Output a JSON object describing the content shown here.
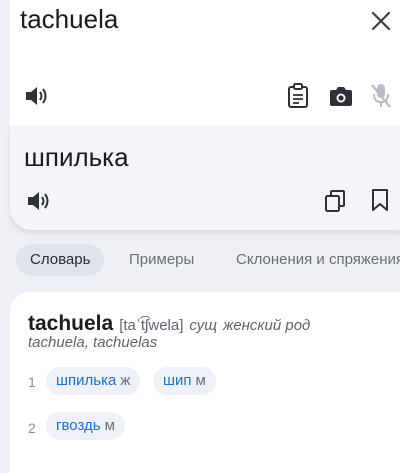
{
  "source": {
    "text": "tachuela"
  },
  "target": {
    "text": "шпилька"
  },
  "icons": {
    "close": "close-icon",
    "speaker": "speaker-icon",
    "clipboard": "clipboard-icon",
    "camera": "camera-icon",
    "mic_off": "mic-off-icon",
    "copy": "copy-icon",
    "bookmark": "bookmark-icon"
  },
  "tabs": [
    {
      "label": "Словарь",
      "active": true
    },
    {
      "label": "Примеры",
      "active": false
    },
    {
      "label": "Склонения и спряжения",
      "active": false
    }
  ],
  "dictionary": {
    "headword": "tachuela",
    "pronunciation": "[taˈt͡ʃwela]",
    "part_of_speech": "сущ",
    "gender": "женский род",
    "forms": "tachuela, tachuelas",
    "senses": [
      {
        "number": "1",
        "translations": [
          {
            "word": "шпилька",
            "gender": "ж"
          },
          {
            "word": "шип",
            "gender": "м"
          }
        ]
      },
      {
        "number": "2",
        "translations": [
          {
            "word": "гвоздь",
            "gender": "м"
          }
        ]
      }
    ]
  },
  "colors": {
    "link": "#1a73c8",
    "background": "#eef0f6",
    "chip": "#eef1f7"
  }
}
